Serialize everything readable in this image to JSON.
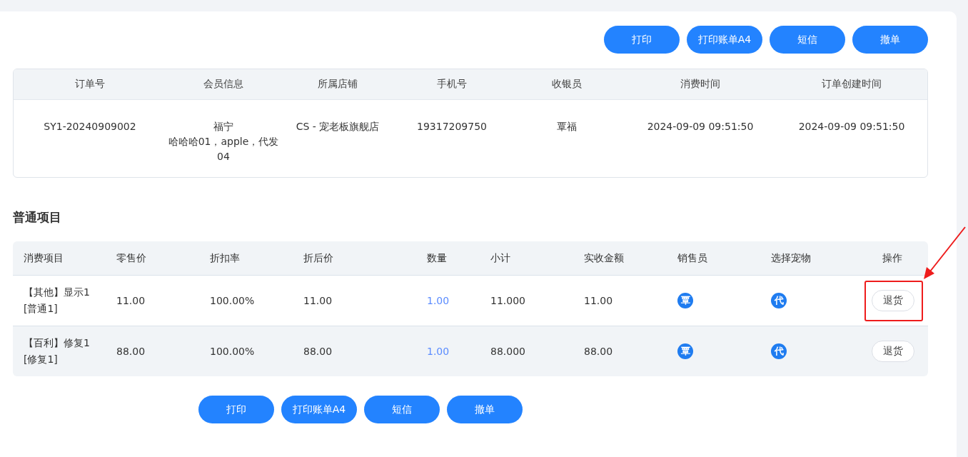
{
  "top_actions": [
    "打印",
    "打印账单A4",
    "短信",
    "撤单"
  ],
  "order_table": {
    "columns": [
      "订单号",
      "会员信息",
      "所属店铺",
      "手机号",
      "收银员",
      "消费时间",
      "订单创建时间"
    ],
    "rows": [
      [
        [
          "SY1-20240909002"
        ],
        [
          "福宁",
          "哈哈哈01，apple，代发04"
        ],
        [
          "CS - 宠老板旗舰店"
        ],
        [
          "19317209750"
        ],
        [
          "覃福"
        ],
        [
          "2024-09-09 09:51:50"
        ],
        [
          "2024-09-09 09:51:50"
        ]
      ]
    ]
  },
  "section_title": "普通项目",
  "items_table": {
    "columns": [
      "消费项目",
      "零售价",
      "折扣率",
      "折后价",
      "数量",
      "小计",
      "实收金额",
      "销售员",
      "选择宠物",
      "操作"
    ],
    "rows": [
      {
        "name": "【其他】显示1",
        "tag": "[普通1]",
        "retail": "11.00",
        "discount": "100.00%",
        "after": "11.00",
        "qty": "1.00",
        "subtotal": "11.000",
        "received": "11.00",
        "seller": "覃",
        "pet": "代",
        "action": "退货",
        "highlighted": true
      },
      {
        "name": "【百利】修复1",
        "tag": "[修复1]",
        "retail": "88.00",
        "discount": "100.00%",
        "after": "88.00",
        "qty": "1.00",
        "subtotal": "88.000",
        "received": "88.00",
        "seller": "覃",
        "pet": "代",
        "action": "退货",
        "highlighted": false
      }
    ]
  },
  "bottom_actions": [
    "打印",
    "打印账单A4",
    "短信",
    "撤单"
  ]
}
